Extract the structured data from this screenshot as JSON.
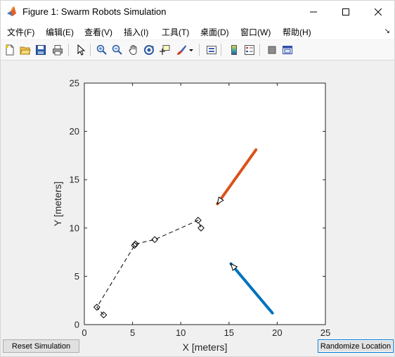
{
  "window": {
    "title": "Figure 1: Swarm Robots Simulation"
  },
  "menu": {
    "items": [
      "文件(F)",
      "编辑(E)",
      "查看(V)",
      "插入(I)",
      "工具(T)",
      "桌面(D)",
      "窗口(W)",
      "帮助(H)"
    ]
  },
  "toolbar": {
    "buttons": [
      "new-figure-icon",
      "open-file-icon",
      "save-icon",
      "print-icon",
      "select-arrow-icon",
      "zoom-in-icon",
      "zoom-out-icon",
      "pan-hand-icon",
      "rotate-3d-icon",
      "data-cursor-icon",
      "brush-icon",
      "link-plot-icon",
      "colorbar-icon",
      "legend-icon",
      "hide-plot-tools-icon",
      "show-plot-tools-icon"
    ]
  },
  "buttons": {
    "reset": "Reset Simulation",
    "randomize": "Randomize Location"
  },
  "chart_data": {
    "type": "line",
    "xlabel": "X [meters]",
    "ylabel": "Y [meters]",
    "xlim": [
      0,
      25
    ],
    "ylim": [
      0,
      25
    ],
    "xticks": [
      0,
      5,
      10,
      15,
      20,
      25
    ],
    "yticks": [
      0,
      5,
      10,
      15,
      20,
      25
    ],
    "grid": false,
    "series": [
      {
        "style": "dashed-black-diamond",
        "x": [
          2.0,
          1.3,
          5.2,
          5.3,
          7.3,
          11.8,
          12.1
        ],
        "y": [
          1.0,
          1.8,
          8.2,
          8.35,
          8.8,
          10.8,
          10.0
        ]
      }
    ],
    "arrows": [
      {
        "color": "#d95319",
        "from": [
          17.8,
          18.1
        ],
        "to": [
          13.8,
          12.5
        ]
      },
      {
        "color": "#0072bd",
        "from": [
          19.5,
          1.2
        ],
        "to": [
          15.2,
          6.3
        ]
      }
    ]
  }
}
